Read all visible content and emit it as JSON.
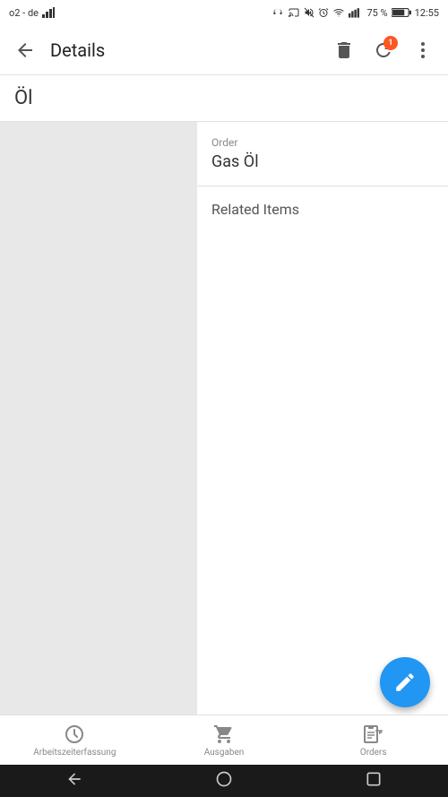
{
  "statusBar": {
    "carrier": "o2 - de",
    "signal": "▪▪▪",
    "time": "12:55",
    "battery": "75 %"
  },
  "appBar": {
    "title": "Details",
    "notificationCount": "1"
  },
  "pageTitleText": "Öl",
  "orderCard": {
    "label": "Order",
    "value": "Gas Öl"
  },
  "relatedItemsCard": {
    "title": "Related Items"
  },
  "bottomNav": {
    "items": [
      {
        "label": "Arbeitszeiterfassung"
      },
      {
        "label": "Ausgaben"
      },
      {
        "label": "Orders"
      }
    ]
  },
  "fab": {
    "label": "Edit"
  }
}
